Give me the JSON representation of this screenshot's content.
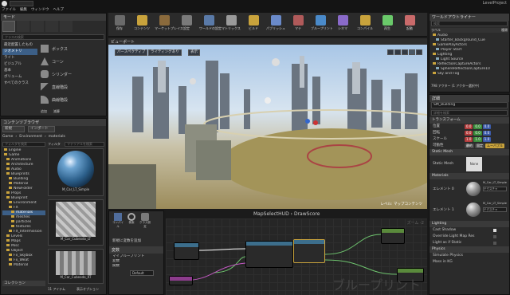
{
  "title_bar": {
    "app_title": "LevelProject"
  },
  "menu": {
    "items": [
      "ファイル",
      "編集",
      "ウィンドウ",
      "ヘルプ"
    ]
  },
  "modes": {
    "header": "モード",
    "search_placeholder": "クラスの検索",
    "categories": [
      "最近配置したもの",
      "ジオメトリ",
      "ライト",
      "ビジュアル",
      "基本",
      "ボリューム",
      "すべてのクラス"
    ],
    "assets": [
      "ボックス",
      "コーン",
      "シリンダー",
      "直線階段",
      "曲線階段"
    ],
    "footer": [
      "追加",
      "減算"
    ]
  },
  "content_browser": {
    "header": "コンテンツブラウザ",
    "new_label": "新規",
    "import_label": "インポート",
    "path": [
      "Game",
      "Environment",
      "materials"
    ],
    "filter_label": "フィルタ",
    "search_placeholder": "マテリアルを検索",
    "folder_search": "フォルダを検索",
    "tree": [
      "Engine",
      "Game",
      "Animations",
      "Architecture",
      "Audio",
      "Blueprints",
      "Building",
      "Material",
      "NewFolder",
      "Props",
      "Blueprint",
      "Environment",
      "FX",
      "materials",
      "meshes",
      "particles",
      "textures",
      "FX_Intermission",
      "Levels",
      "Maps",
      "Misc",
      "Object",
      "Fx_Skybox",
      "Fx_Weat",
      "Material",
      "Misc",
      "Ymos",
      "Particles"
    ],
    "assets": [
      {
        "label": "M_Car_LT_Simple"
      },
      {
        "label": "M_Car_Cubeodo_LT"
      },
      {
        "label": "M_Car_Cubeodo_RT"
      }
    ],
    "collection_label": "コレクション",
    "footer_count": "11 アイテム",
    "view_options": "表示オプション"
  },
  "toolbar": {
    "buttons": [
      "保存",
      "コンテンツ",
      "マーケットプレイス",
      "設定",
      "ワールドの設定",
      "マトリックス",
      "ビルド",
      "パブリッシュ",
      "マテ",
      "ブループリント",
      "シネマ",
      "コンパイル",
      "再生",
      "起動"
    ]
  },
  "viewport": {
    "tab": "ビューポート",
    "perspective": "パースペクティブ",
    "lit": "ライティングあり",
    "show": "表示",
    "footer_label": "レベル: マップコンテンツ"
  },
  "blueprint": {
    "title": "MapSelectHUD",
    "function": "DrawScore",
    "watermark": "ブループリント",
    "zoom": "ズーム -2",
    "toolbar_labels": [
      "コンパイル",
      "検索",
      "クラス設定"
    ],
    "palette_title": "コンポーネント",
    "add_label": "新規に変数を追加",
    "variables_header": "変数",
    "variable_rows": [
      "マイブループリント",
      "変数",
      "関数"
    ],
    "default_value": "Default"
  },
  "outliner": {
    "header": "ワールドアウトライナー",
    "search_placeholder": "検索",
    "columns": [
      "ラベル",
      "種類"
    ],
    "rows": [
      "Audio",
      "Starter_Background_Cue",
      "GamePlayActors",
      "Player Start",
      "Lighting",
      "Light Source",
      "ReflectionCaptureActors",
      "SphereReflectionCapture10",
      "Sky and Fog"
    ],
    "footer": "798 アクター (1 アクター選択中)",
    "view_options": "表示オプション"
  },
  "details": {
    "header": "詳細",
    "actor_name": "SM_Building",
    "search_placeholder": "詳細を検索",
    "transform_header": "トランスフォーム",
    "location_label": "位置",
    "rotation_label": "回転",
    "scale_label": "スケール",
    "mobility_label": "可動性",
    "location": [
      "0.0",
      "0.0",
      "0.0"
    ],
    "rotation": [
      "0.0",
      "0.0",
      "0.0"
    ],
    "scale": [
      "1.0",
      "1.0",
      "1.0"
    ],
    "mobility": [
      "静的",
      "固定",
      "ムーバブル"
    ],
    "static_mesh_header": "Static Mesh",
    "static_mesh_label": "Static Mesh",
    "static_mesh_value": "None",
    "materials_header": "Materials",
    "element0": "エレメント 0",
    "element1": "エレメント 1",
    "mat0": "M_Car_LT_Simple",
    "mat1": "M_Car_LT_Simple",
    "texture_label": "テクスチャ",
    "lighting_header": "Lighting",
    "lighting_rows": [
      "Cast Shadow",
      "Override Light Map Res",
      "Light as if Static"
    ],
    "physics_header": "Physics",
    "physics_rows": [
      "Simulate Physics",
      "Mass in KG"
    ]
  },
  "colors": {
    "accent": "#c9a33c",
    "selection": "#3c5f87",
    "exec_wire": "#ffffff",
    "float_wire": "#6ec36e"
  }
}
